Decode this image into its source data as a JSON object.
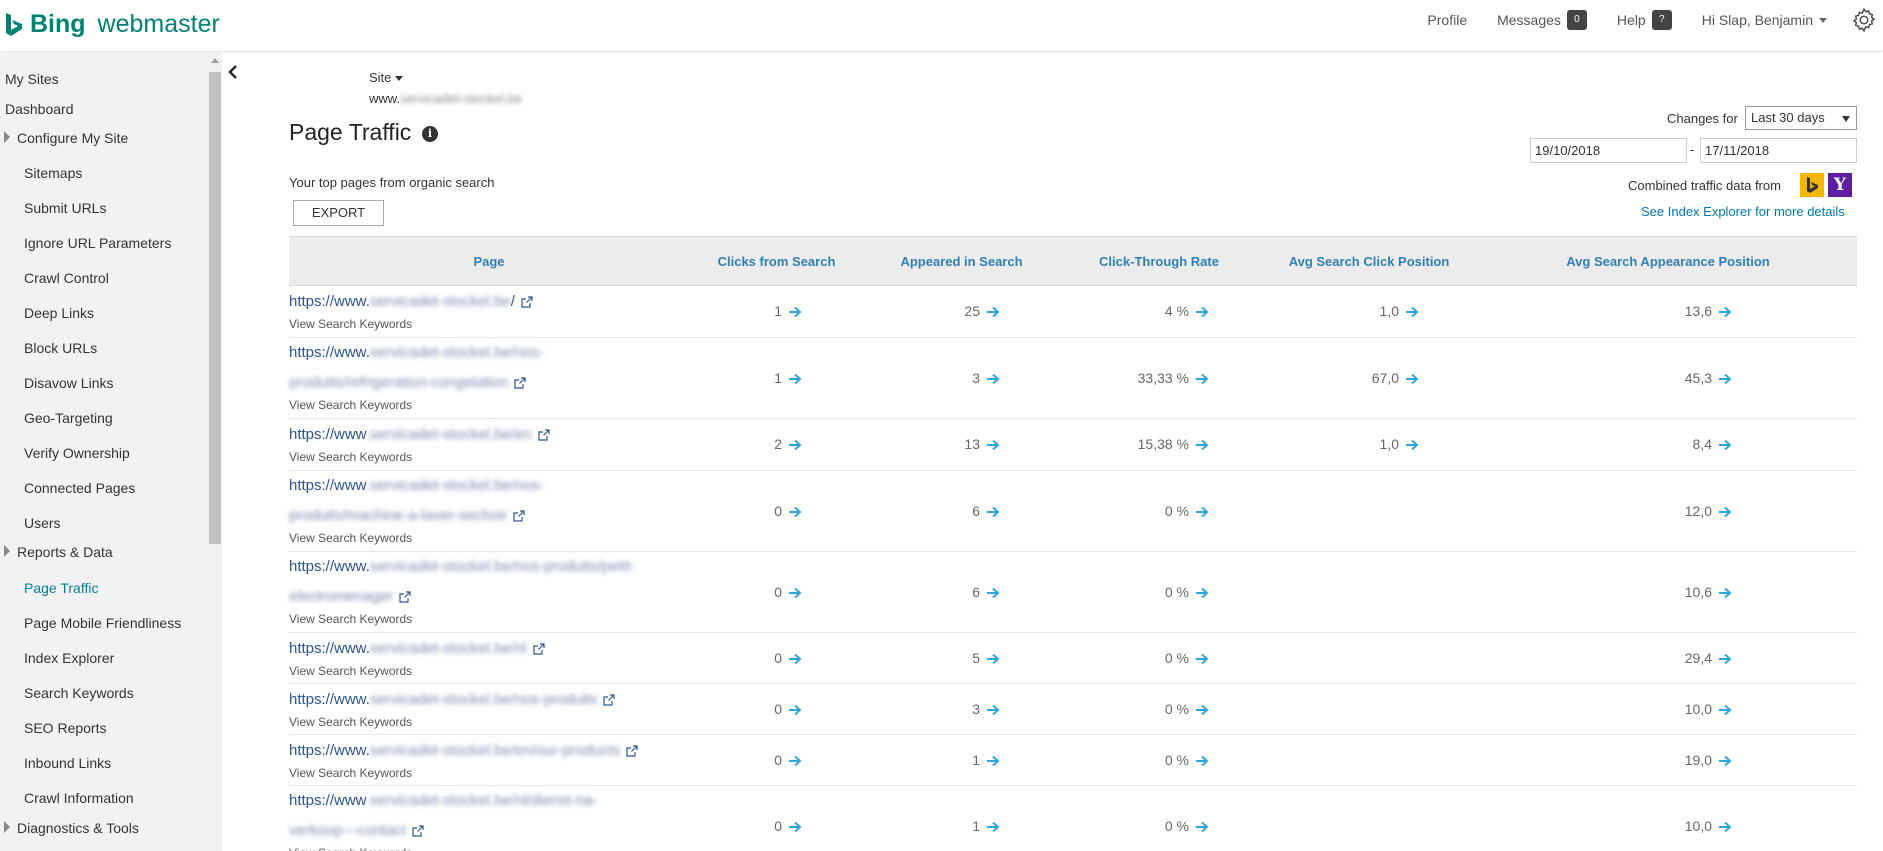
{
  "brand": {
    "bing": "Bing",
    "product": "webmaster",
    "color": "#008373"
  },
  "topnav": {
    "profile": "Profile",
    "messages": "Messages",
    "messages_count": "0",
    "help": "Help",
    "help_badge": "?",
    "greeting": "Hi Slap, Benjamin"
  },
  "sidebar": {
    "my_sites": "My Sites",
    "dashboard": "Dashboard",
    "configure": "Configure My Site",
    "configure_items": [
      "Sitemaps",
      "Submit URLs",
      "Ignore URL Parameters",
      "Crawl Control",
      "Deep Links",
      "Block URLs",
      "Disavow Links",
      "Geo-Targeting",
      "Verify Ownership",
      "Connected Pages",
      "Users"
    ],
    "reports": "Reports & Data",
    "reports_items": [
      "Page Traffic",
      "Page Mobile Friendliness",
      "Index Explorer",
      "Search Keywords",
      "SEO Reports",
      "Inbound Links",
      "Crawl Information"
    ],
    "diagnostics": "Diagnostics & Tools",
    "active_color": "#00809d"
  },
  "site": {
    "label": "Site",
    "url_prefix": "www.",
    "url_blurred": "servicadet-stockel.be"
  },
  "page": {
    "title": "Page Traffic",
    "info_glyph": "i",
    "subtitle": "Your top pages from organic search",
    "export": "EXPORT"
  },
  "filters": {
    "changes_for": "Changes for",
    "range": "Last 30 days",
    "date_from": "19/10/2018",
    "date_sep": "-",
    "date_to": "17/11/2018",
    "combined": "Combined traffic data from",
    "yahoo_glyph": "Y",
    "see_index": "See Index Explorer for more details"
  },
  "table": {
    "headers": [
      "Page",
      "Clicks from Search",
      "Appeared in Search",
      "Click-Through Rate",
      "Avg Search Click Position",
      "Avg Search Appearance Position"
    ],
    "view_keywords": "View Search Keywords",
    "rows": [
      {
        "line1": "https://www.",
        "blur1": "servicadet-stockel.be",
        "tail1": "/",
        "line2": "",
        "blur2": "",
        "clicks": "1",
        "appeared": "25",
        "ctr": "4 %",
        "click_pos": "1,0",
        "appear_pos": "13,6"
      },
      {
        "line1": "https://www.",
        "blur1": "servicadet-stockel.be/nos-",
        "tail1": "",
        "line2": "",
        "blur2": "produits/refrigeration-congelation",
        "clicks": "1",
        "appeared": "3",
        "ctr": "33,33 %",
        "click_pos": "67,0",
        "appear_pos": "45,3"
      },
      {
        "line1": "https://www",
        "blur1": ".servicadet-stockel.be/en",
        "tail1": "",
        "line2": "",
        "blur2": "",
        "clicks": "2",
        "appeared": "13",
        "ctr": "15,38 %",
        "click_pos": "1,0",
        "appear_pos": "8,4"
      },
      {
        "line1": "https://www",
        "blur1": ".servicadet-stockel.be/nos-",
        "tail1": "",
        "line2": "",
        "blur2": "produits/machine-a-laver-sechoir",
        "clicks": "0",
        "appeared": "6",
        "ctr": "0 %",
        "click_pos": "",
        "appear_pos": "12,0"
      },
      {
        "line1": "https://www.",
        "blur1": "servicadet-stockel.be/nos-produits/petit-",
        "tail1": "",
        "line2": "",
        "blur2": "electromenager",
        "clicks": "0",
        "appeared": "6",
        "ctr": "0 %",
        "click_pos": "",
        "appear_pos": "10,6"
      },
      {
        "line1": "https://www.",
        "blur1": "servicadet-stockel.be/nl",
        "tail1": "",
        "line2": "",
        "blur2": "",
        "clicks": "0",
        "appeared": "5",
        "ctr": "0 %",
        "click_pos": "",
        "appear_pos": "29,4"
      },
      {
        "line1": "https://www.",
        "blur1": "servicadet-stockel.be/nos-produits",
        "tail1": "",
        "line2": "",
        "blur2": "",
        "clicks": "0",
        "appeared": "3",
        "ctr": "0 %",
        "click_pos": "",
        "appear_pos": "10,0"
      },
      {
        "line1": "https://www.",
        "blur1": "servicadet-stockel.be/en/our-products",
        "tail1": "",
        "line2": "",
        "blur2": "",
        "clicks": "0",
        "appeared": "1",
        "ctr": "0 %",
        "click_pos": "",
        "appear_pos": "19,0"
      },
      {
        "line1": "https://www",
        "blur1": ".servicadet-stockel.be/nl/dienst-na-",
        "tail1": "",
        "line2": "",
        "blur2": "verkoop---contact",
        "clicks": "0",
        "appeared": "1",
        "ctr": "0 %",
        "click_pos": "",
        "appear_pos": "10,0"
      }
    ]
  }
}
